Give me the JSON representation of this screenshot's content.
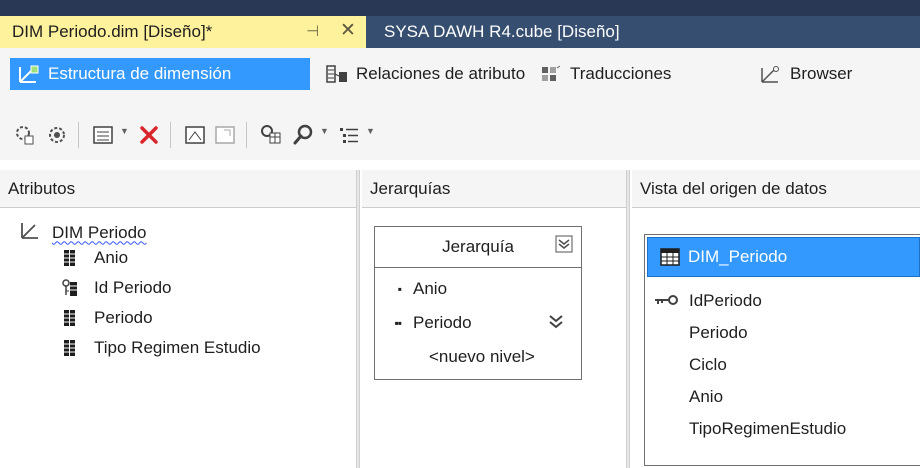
{
  "document_tabs": [
    {
      "label": "DIM Periodo.dim [Diseño]*",
      "active": true,
      "pin_glyph": "⊣",
      "close_glyph": "✕"
    },
    {
      "label": "SYSA DAWH R4.cube [Diseño]",
      "active": false
    }
  ],
  "designer_tabs": [
    {
      "label": "Estructura de dimensión",
      "icon": "dimension-structure-icon",
      "active": true
    },
    {
      "label": "Relaciones de atributo",
      "icon": "attribute-relationships-icon",
      "active": false
    },
    {
      "label": "Traducciones",
      "icon": "translations-icon",
      "active": false
    },
    {
      "label": "Browser",
      "icon": "browser-icon",
      "active": false
    }
  ],
  "panes": {
    "attributes": {
      "title": "Atributos",
      "root": "DIM Periodo",
      "items": [
        {
          "label": "Anio",
          "icon": "attribute-icon"
        },
        {
          "label": "Id Periodo",
          "icon": "key-attribute-icon"
        },
        {
          "label": "Periodo",
          "icon": "attribute-icon"
        },
        {
          "label": "Tipo Regimen Estudio",
          "icon": "attribute-icon"
        }
      ]
    },
    "hierarchies": {
      "title": "Jerarquías",
      "hierarchy_name": "Jerarquía",
      "levels": [
        {
          "label": "Anio",
          "bullet": "▪"
        },
        {
          "label": "Periodo",
          "bullet": "▪▪"
        }
      ],
      "new_level": "<nuevo nivel>"
    },
    "data_source_view": {
      "title": "Vista del origen de datos",
      "table": "DIM_Periodo",
      "columns": [
        "IdPeriodo",
        "Periodo",
        "Ciclo",
        "Anio",
        "TipoRegimenEstudio"
      ],
      "key_column": "IdPeriodo"
    }
  },
  "colors": {
    "tab_active_bg": "#fff29d",
    "tab_bar_bg": "#293955",
    "selection_blue": "#3399ff"
  }
}
